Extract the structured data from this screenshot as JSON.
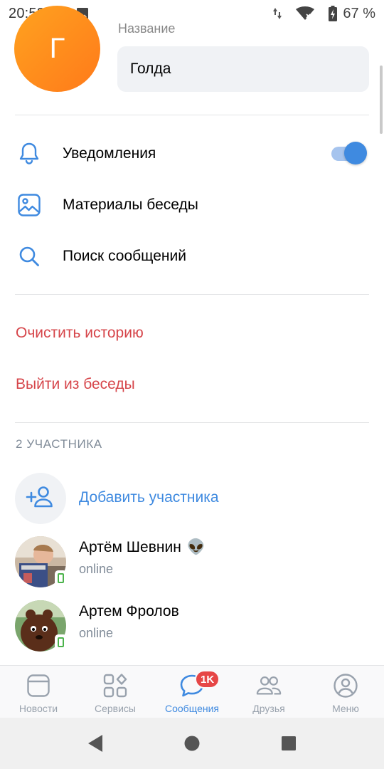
{
  "status_bar": {
    "time": "20:58",
    "icons": [
      "message-icon",
      "image-icon",
      "data-arrows-icon",
      "wifi-icon",
      "battery-charging-icon"
    ],
    "battery": "67 %"
  },
  "chat": {
    "avatar_letter": "Г",
    "name_label": "Название",
    "name_value": "Голда"
  },
  "menu": {
    "notifications": "Уведомления",
    "notifications_on": true,
    "materials": "Материалы беседы",
    "search": "Поиск сообщений"
  },
  "actions": {
    "clear_history": "Очистить историю",
    "leave": "Выйти из беседы"
  },
  "members": {
    "title": "2 УЧАСТНИКА",
    "add_label": "Добавить участника",
    "list": [
      {
        "name": "Артём Шевнин",
        "emoji": "👽",
        "status": "online"
      },
      {
        "name": "Артем Фролов",
        "emoji": "",
        "status": "online"
      }
    ]
  },
  "tabbar": {
    "tabs": [
      {
        "label": "Новости",
        "icon": "news-icon"
      },
      {
        "label": "Сервисы",
        "icon": "services-icon"
      },
      {
        "label": "Сообщения",
        "icon": "messages-icon",
        "badge": "1K",
        "active": true
      },
      {
        "label": "Друзья",
        "icon": "friends-icon"
      },
      {
        "label": "Меню",
        "icon": "profile-icon"
      }
    ]
  },
  "colors": {
    "accent": "#3f8ae0",
    "danger": "#d6454a",
    "avatar_orange": "#ff8c1a",
    "online": "#4bb34b",
    "badge": "#e64646"
  }
}
